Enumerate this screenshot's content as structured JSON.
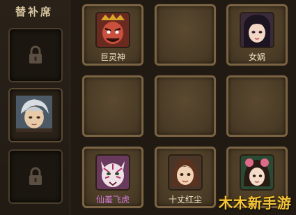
{
  "bench": {
    "title": "替补席",
    "slots": [
      {
        "state": "locked"
      },
      {
        "state": "hero",
        "portrait": "silver-haired-hero"
      },
      {
        "state": "locked"
      }
    ]
  },
  "lineup": {
    "cells": [
      {
        "name": "巨灵神",
        "portrait": "giant-spirit-god"
      },
      {
        "name": ""
      },
      {
        "name": "女娲",
        "portrait": "nuwa"
      },
      {
        "name": ""
      },
      {
        "name": ""
      },
      {
        "name": ""
      },
      {
        "name": "仙羞飞虎",
        "portrait": "tiger-spirit",
        "color": "#d07ad8"
      },
      {
        "name": "十丈红尘",
        "portrait": "red-dust-girl"
      },
      {
        "name": "",
        "portrait": "flower-fairy"
      }
    ]
  },
  "watermark": "木木新手游",
  "colors": {
    "accent_gold": "#f5c63a",
    "cell_border": "#7a6342",
    "name_purple": "#d07ad8"
  }
}
